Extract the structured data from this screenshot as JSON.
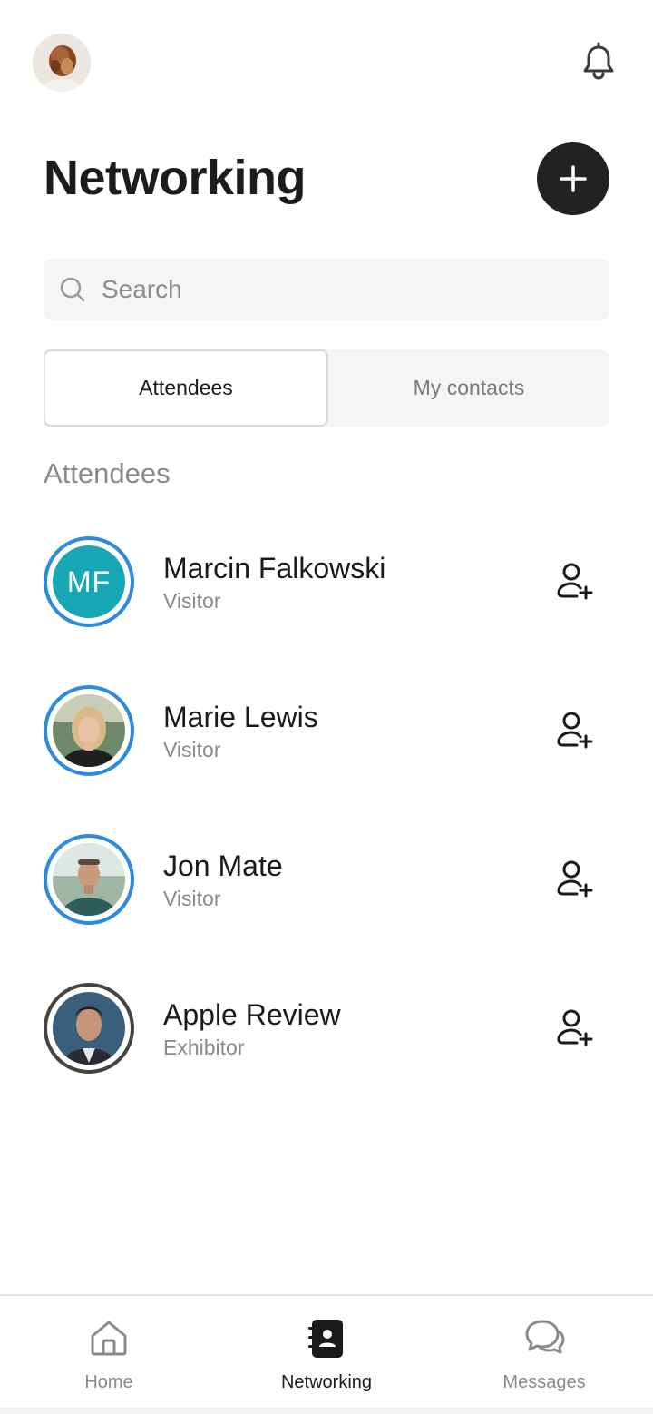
{
  "header": {
    "title": "Networking"
  },
  "search": {
    "placeholder": "Search",
    "value": ""
  },
  "tabs": [
    {
      "label": "Attendees",
      "active": true
    },
    {
      "label": "My contacts",
      "active": false
    }
  ],
  "section_label": "Attendees",
  "attendees": [
    {
      "name": "Marcin Falkowski",
      "role": "Visitor",
      "initials": "MF",
      "avatar": "initials"
    },
    {
      "name": "Marie Lewis",
      "role": "Visitor",
      "avatar": "photo-woman"
    },
    {
      "name": "Jon Mate",
      "role": "Visitor",
      "avatar": "photo-man-outdoor"
    },
    {
      "name": "Apple Review",
      "role": "Exhibitor",
      "avatar": "photo-man-portrait"
    }
  ],
  "nav": [
    {
      "label": "Home",
      "icon": "home-icon",
      "active": false
    },
    {
      "label": "Networking",
      "icon": "contacts-book-icon",
      "active": true
    },
    {
      "label": "Messages",
      "icon": "chat-bubbles-icon",
      "active": false
    }
  ],
  "colors": {
    "accent_ring": "#2e8bdb",
    "exhibitor_ring": "#444444",
    "initials_bg": "#17a7b5",
    "dark_button": "#222222"
  }
}
